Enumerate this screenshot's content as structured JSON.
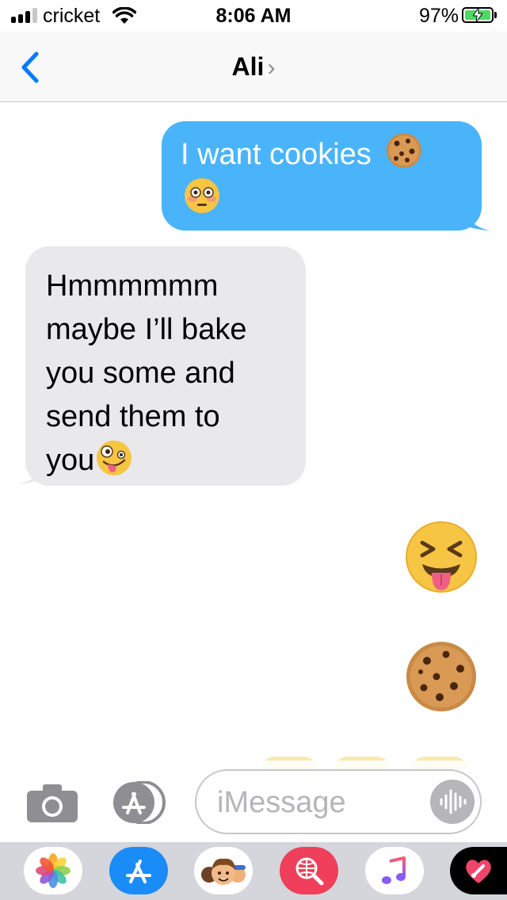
{
  "status_bar": {
    "carrier": "cricket",
    "time": "8:06 AM",
    "battery_percent": "97%",
    "signal_bars": 3,
    "battery_level": 0.97,
    "charging": true
  },
  "nav": {
    "contact_name": "Ali",
    "back_icon": "chevron-left-icon",
    "details_icon": "chevron-right-icon"
  },
  "messages": {
    "sent_1": {
      "text": "I want cookies",
      "emojis": [
        "cookie-emoji",
        "flushed-face-emoji"
      ]
    },
    "received_1": {
      "lines": [
        "Hmmmmmm",
        "maybe I’ll bake",
        "you some and",
        "send them to",
        "you"
      ],
      "emojis": [
        "zany-face-emoji"
      ]
    },
    "sent_2": {
      "emoji": "squinting-face-with-tongue-emoji"
    },
    "sent_3": {
      "emoji": "cookie-emoji"
    }
  },
  "input": {
    "placeholder": "iMessage",
    "value": ""
  },
  "app_drawer": [
    "photos-app",
    "app-store-app",
    "memoji-app",
    "search-images-app",
    "music-app",
    "digital-touch-app"
  ],
  "colors": {
    "sent_bubble": "#4ab4fb",
    "received_bubble": "#e9e9eb",
    "accent": "#007aff",
    "battery_green": "#4cd964"
  }
}
